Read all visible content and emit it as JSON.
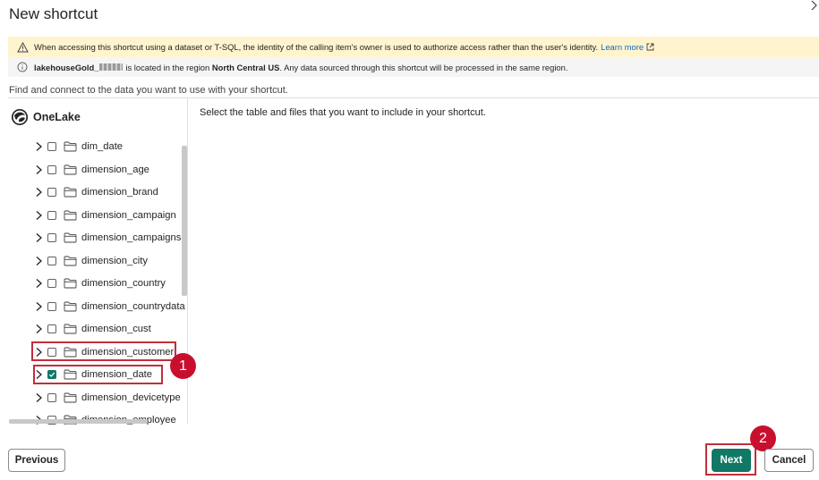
{
  "dialog": {
    "title": "New shortcut"
  },
  "warning": {
    "text": "When accessing this shortcut using a dataset or T-SQL, the identity of the calling item's owner is used to authorize access rather than the user's identity.",
    "link": "Learn more"
  },
  "info": {
    "name_prefix": "lakehouseGold_",
    "middle": "is located in the region",
    "region": "North Central US",
    "suffix": ". Any data sourced through this shortcut will be processed in the same region."
  },
  "instructions": "Find and connect to the data you want to use with your shortcut.",
  "source": {
    "label": "OneLake"
  },
  "tree": {
    "items": [
      {
        "label": "dim_date",
        "checked": false
      },
      {
        "label": "dimension_age",
        "checked": false
      },
      {
        "label": "dimension_brand",
        "checked": false
      },
      {
        "label": "dimension_campaign",
        "checked": false
      },
      {
        "label": "dimension_campaignse",
        "checked": false
      },
      {
        "label": "dimension_city",
        "checked": false
      },
      {
        "label": "dimension_country",
        "checked": false
      },
      {
        "label": "dimension_countrydata",
        "checked": false
      },
      {
        "label": "dimension_cust",
        "checked": false
      },
      {
        "label": "dimension_customer",
        "checked": false
      },
      {
        "label": "dimension_date",
        "checked": true
      },
      {
        "label": "dimension_devicetype",
        "checked": false
      },
      {
        "label": "dimension_employee",
        "checked": false
      }
    ]
  },
  "right_pane": {
    "text": "Select the table and files that you want to include in your shortcut."
  },
  "annotations": {
    "step1": "1",
    "step2": "2"
  },
  "footer": {
    "previous": "Previous",
    "next": "Next",
    "cancel": "Cancel"
  },
  "colors": {
    "primary": "#117865",
    "warning_bg": "#fff4ce",
    "info_bg": "#f5f5f5",
    "annotation": "#c8102e",
    "link": "#0f6cbd"
  }
}
